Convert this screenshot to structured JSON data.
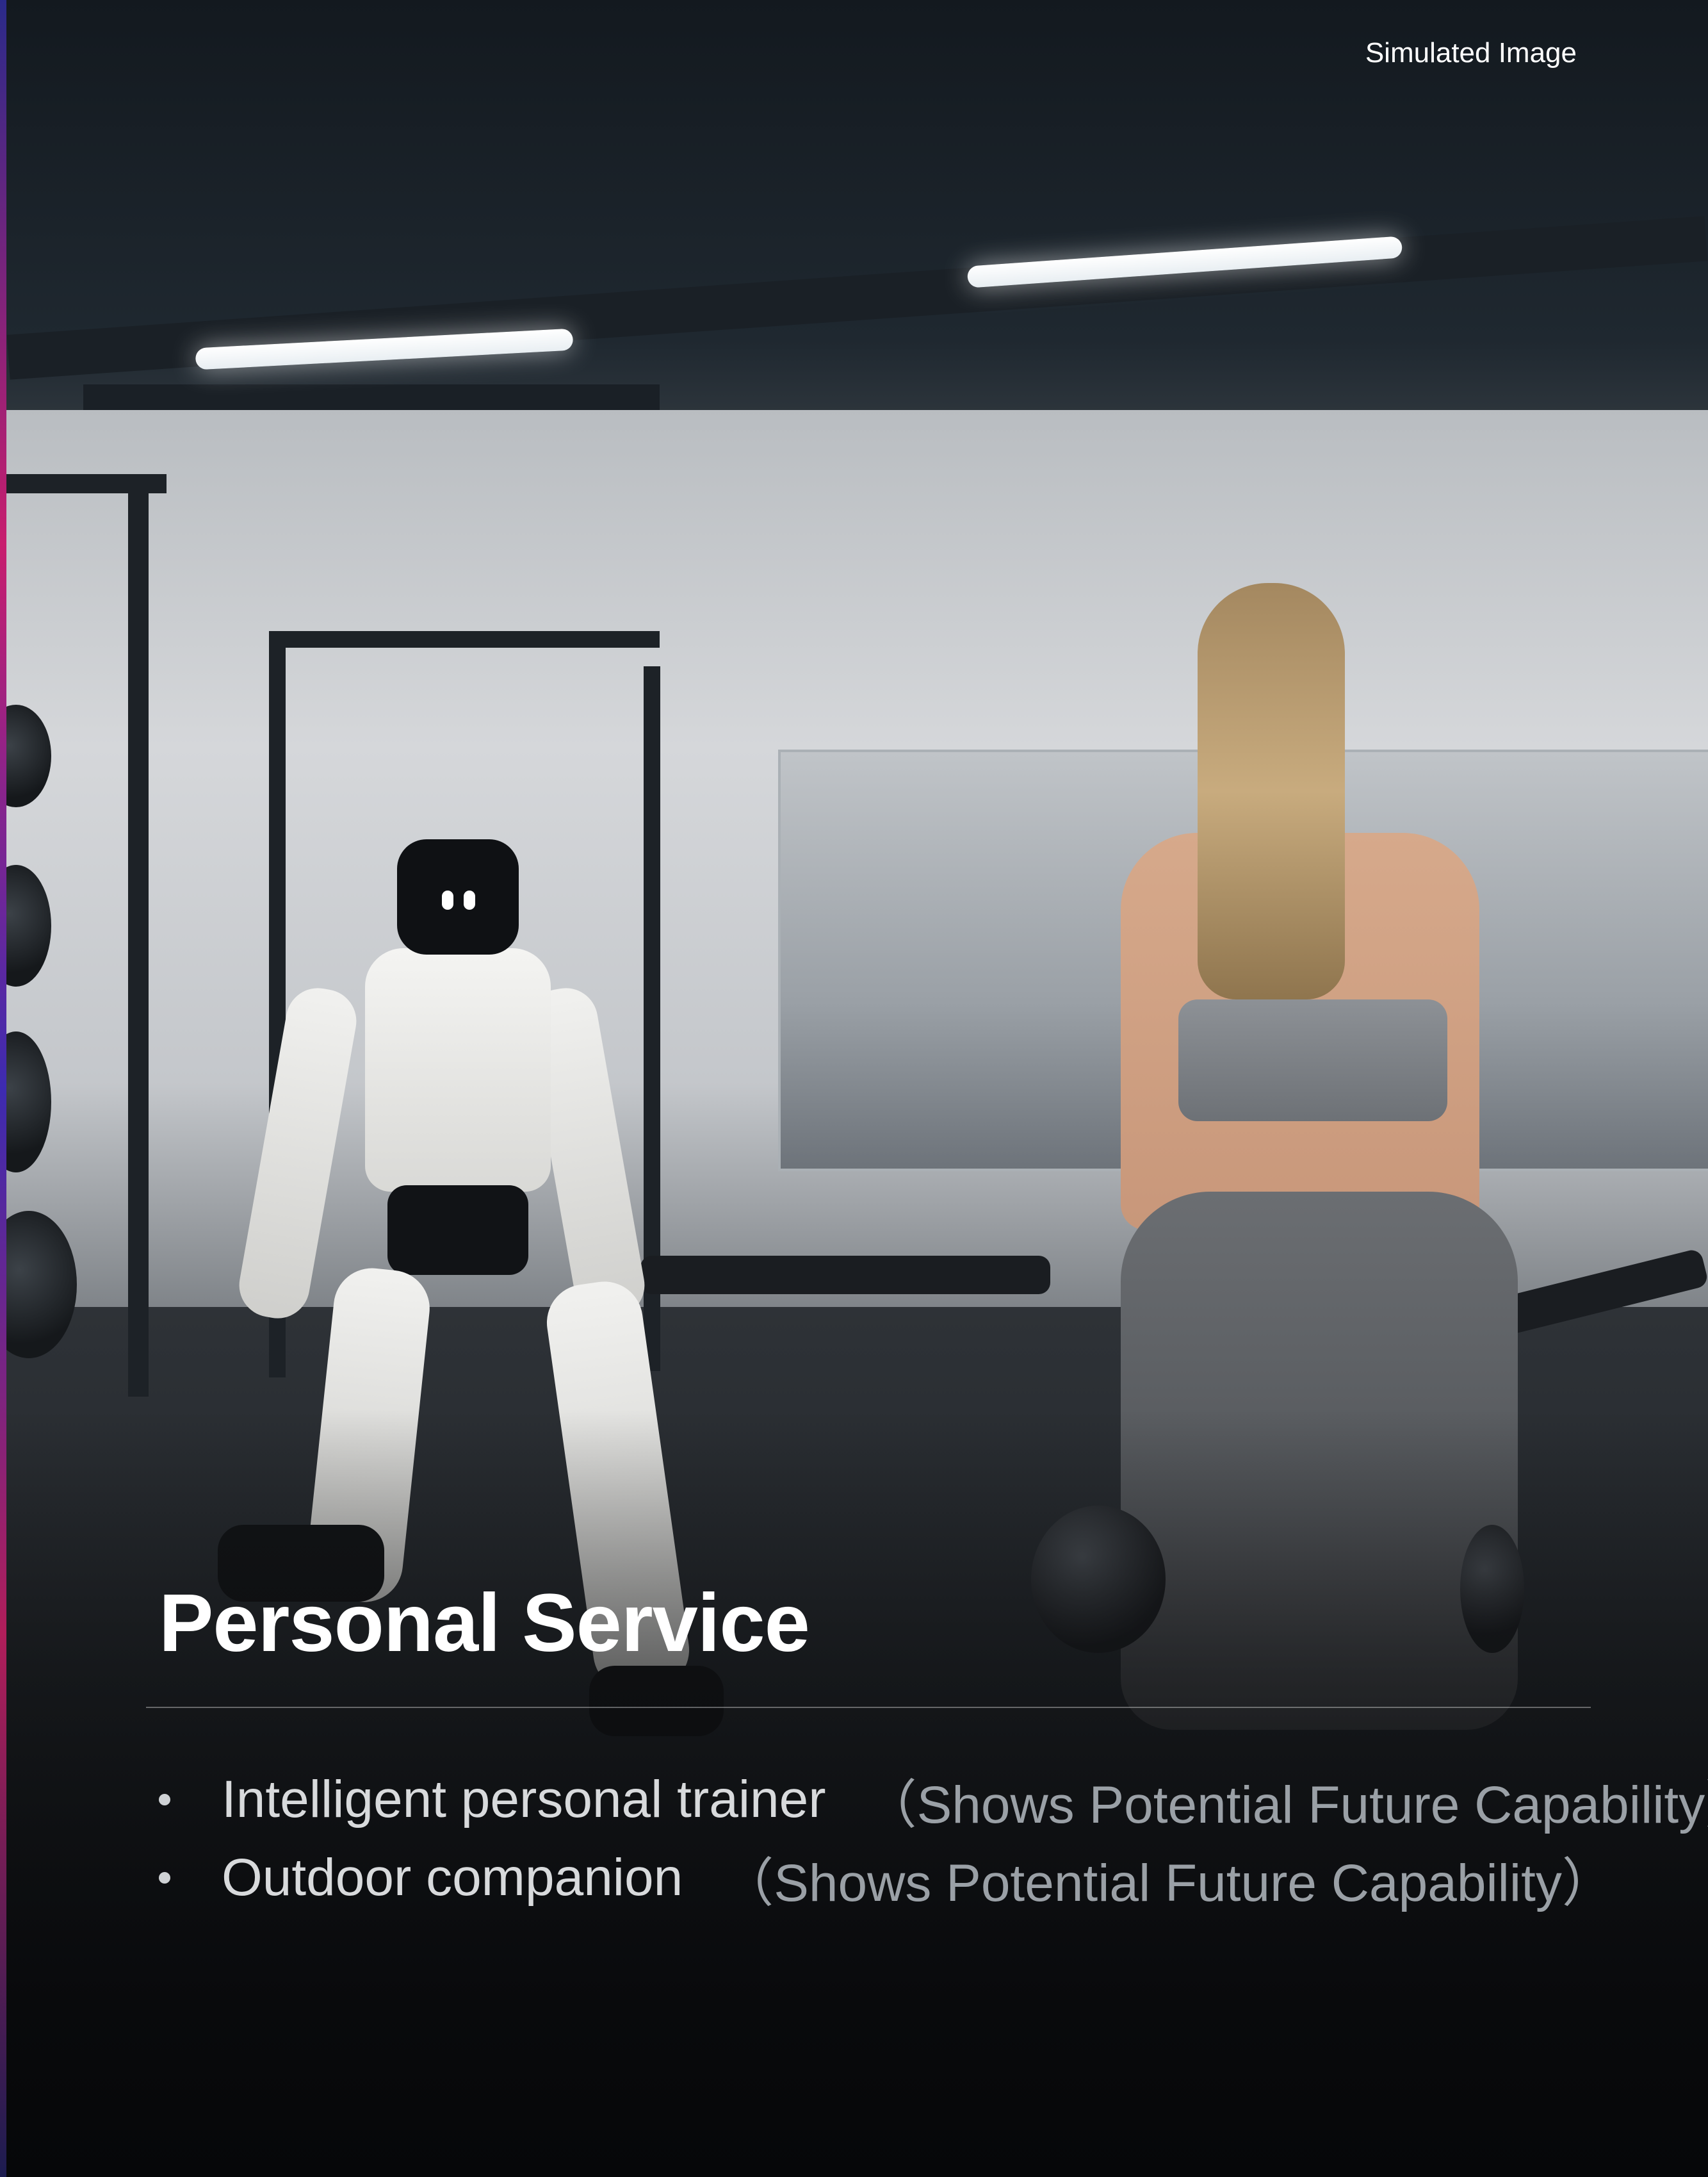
{
  "badge": {
    "label": "Simulated Image"
  },
  "headline": "Personal Service",
  "bullets": [
    {
      "text": "Intelligent personal trainer",
      "note": "（Shows Potential Future Capability）"
    },
    {
      "text": "Outdoor companion",
      "note": "（Shows Potential Future Capability）"
    }
  ],
  "colors": {
    "text_primary": "#ffffff",
    "text_secondary": "#d8dadc",
    "note": "#9aa0a6",
    "accent_bar": [
      "#2a2a8a",
      "#c81e6e",
      "#3d2bb0"
    ]
  }
}
